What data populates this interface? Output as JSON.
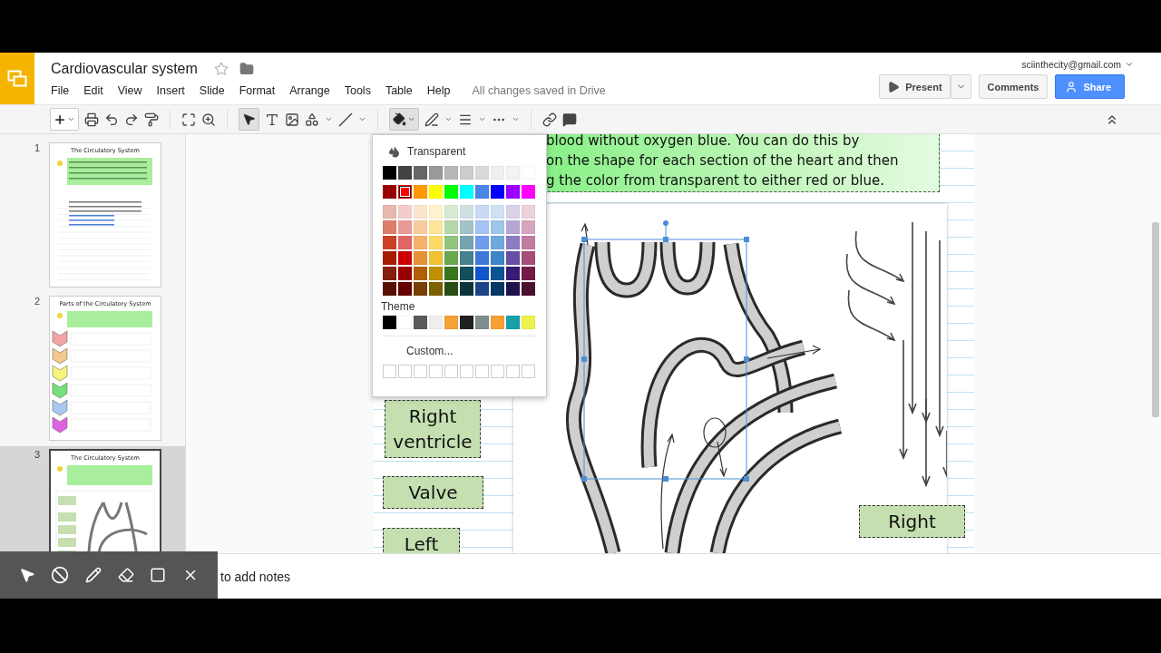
{
  "app": {
    "doc_title": "Cardiovascular system",
    "starred": false,
    "account": "sciinthecity@gmail.com",
    "save_status": "All changes saved in Drive"
  },
  "menu": [
    "File",
    "Edit",
    "View",
    "Insert",
    "Slide",
    "Format",
    "Arrange",
    "Tools",
    "Table",
    "Help"
  ],
  "buttons": {
    "present": "Present",
    "comments": "Comments",
    "share": "Share"
  },
  "toolbar": {
    "select_tool_on": true,
    "fill_menu_open": true
  },
  "filmstrip": [
    {
      "number": "1",
      "title": "The Circulatory System",
      "kind": "text",
      "selected": false
    },
    {
      "number": "2",
      "title": "Parts of the Circulatory System",
      "kind": "chevrons",
      "selected": false
    },
    {
      "number": "3",
      "title": "The Circulatory System",
      "kind": "diagram",
      "selected": true
    }
  ],
  "slide": {
    "instructions": [
      "blood without oxygen blue. You can do this by",
      "on the shape for each section of the heart and then",
      "g the color from transparent to either red or blue."
    ],
    "labels": [
      {
        "text": "Right ventricle"
      },
      {
        "text": "Valve"
      },
      {
        "text": "Left"
      },
      {
        "text": "Right"
      }
    ]
  },
  "fill_menu": {
    "transparent": "Transparent",
    "theme_label": "Theme",
    "custom": "Custom...",
    "rows": [
      [
        {
          "color": "#000000",
          "selected": false
        },
        {
          "color": "#434343",
          "selected": false
        },
        {
          "color": "#666666",
          "selected": false
        },
        {
          "color": "#999999",
          "selected": false
        },
        {
          "color": "#b7b7b7",
          "selected": false
        },
        {
          "color": "#cccccc",
          "selected": false
        },
        {
          "color": "#d9d9d9",
          "selected": false
        },
        {
          "color": "#efefef",
          "selected": false
        },
        {
          "color": "#f3f3f3",
          "selected": false
        },
        {
          "color": "#ffffff",
          "selected": false
        }
      ],
      [
        {
          "color": "#980000",
          "selected": false
        },
        {
          "color": "#ff0000",
          "selected": true
        },
        {
          "color": "#ff9900",
          "selected": false
        },
        {
          "color": "#ffff00",
          "selected": false
        },
        {
          "color": "#00ff00",
          "selected": false
        },
        {
          "color": "#00ffff",
          "selected": false
        },
        {
          "color": "#4a86e8",
          "selected": false
        },
        {
          "color": "#0000ff",
          "selected": false
        },
        {
          "color": "#9900ff",
          "selected": false
        },
        {
          "color": "#ff00ff",
          "selected": false
        }
      ],
      [
        {
          "color": "#e6b8af",
          "selected": false
        },
        {
          "color": "#f4cccc",
          "selected": false
        },
        {
          "color": "#fce5cd",
          "selected": false
        },
        {
          "color": "#fff2cc",
          "selected": false
        },
        {
          "color": "#d9ead3",
          "selected": false
        },
        {
          "color": "#d0e0e3",
          "selected": false
        },
        {
          "color": "#c9daf8",
          "selected": false
        },
        {
          "color": "#cfe2f3",
          "selected": false
        },
        {
          "color": "#d9d2e9",
          "selected": false
        },
        {
          "color": "#ead1dc",
          "selected": false
        }
      ],
      [
        {
          "color": "#dd7e6b",
          "selected": false
        },
        {
          "color": "#ea9999",
          "selected": false
        },
        {
          "color": "#f9cb9c",
          "selected": false
        },
        {
          "color": "#ffe599",
          "selected": false
        },
        {
          "color": "#b6d7a8",
          "selected": false
        },
        {
          "color": "#a2c4c9",
          "selected": false
        },
        {
          "color": "#a4c2f4",
          "selected": false
        },
        {
          "color": "#9fc5e8",
          "selected": false
        },
        {
          "color": "#b4a7d6",
          "selected": false
        },
        {
          "color": "#d5a6bd",
          "selected": false
        }
      ],
      [
        {
          "color": "#cc4125",
          "selected": false
        },
        {
          "color": "#e06666",
          "selected": false
        },
        {
          "color": "#f6b26b",
          "selected": false
        },
        {
          "color": "#ffd966",
          "selected": false
        },
        {
          "color": "#93c47d",
          "selected": false
        },
        {
          "color": "#76a5af",
          "selected": false
        },
        {
          "color": "#6d9eeb",
          "selected": false
        },
        {
          "color": "#6fa8dc",
          "selected": false
        },
        {
          "color": "#8e7cc3",
          "selected": false
        },
        {
          "color": "#c27ba0",
          "selected": false
        }
      ],
      [
        {
          "color": "#a61c00",
          "selected": false
        },
        {
          "color": "#cc0000",
          "selected": false
        },
        {
          "color": "#e69138",
          "selected": false
        },
        {
          "color": "#f1c232",
          "selected": false
        },
        {
          "color": "#6aa84f",
          "selected": false
        },
        {
          "color": "#45818e",
          "selected": false
        },
        {
          "color": "#3c78d8",
          "selected": false
        },
        {
          "color": "#3d85c6",
          "selected": false
        },
        {
          "color": "#674ea7",
          "selected": false
        },
        {
          "color": "#a64d79",
          "selected": false
        }
      ],
      [
        {
          "color": "#85200c",
          "selected": false
        },
        {
          "color": "#990000",
          "selected": false
        },
        {
          "color": "#b45f06",
          "selected": false
        },
        {
          "color": "#bf9000",
          "selected": false
        },
        {
          "color": "#38761d",
          "selected": false
        },
        {
          "color": "#134f5c",
          "selected": false
        },
        {
          "color": "#1155cc",
          "selected": false
        },
        {
          "color": "#0b5394",
          "selected": false
        },
        {
          "color": "#351c75",
          "selected": false
        },
        {
          "color": "#741b47",
          "selected": false
        }
      ],
      [
        {
          "color": "#5b0f00",
          "selected": false
        },
        {
          "color": "#660000",
          "selected": false
        },
        {
          "color": "#783f04",
          "selected": false
        },
        {
          "color": "#7f6000",
          "selected": false
        },
        {
          "color": "#274e13",
          "selected": false
        },
        {
          "color": "#0c343d",
          "selected": false
        },
        {
          "color": "#1c4587",
          "selected": false
        },
        {
          "color": "#073763",
          "selected": false
        },
        {
          "color": "#20124d",
          "selected": false
        },
        {
          "color": "#4c1130",
          "selected": false
        }
      ]
    ],
    "theme": [
      {
        "color": "#000000",
        "selected": false
      },
      {
        "color": "#ffffff",
        "selected": false
      },
      {
        "color": "#595959",
        "selected": false
      },
      {
        "color": "#eeeeee",
        "selected": false
      },
      {
        "color": "#f6a035",
        "selected": false
      },
      {
        "color": "#212121",
        "selected": false
      },
      {
        "color": "#7f8c8d",
        "selected": false
      },
      {
        "color": "#f6a035",
        "selected": false
      },
      {
        "color": "#16a0a8",
        "selected": false
      },
      {
        "color": "#eef24a",
        "selected": false
      }
    ]
  },
  "notes": {
    "placeholder": "to add notes"
  }
}
